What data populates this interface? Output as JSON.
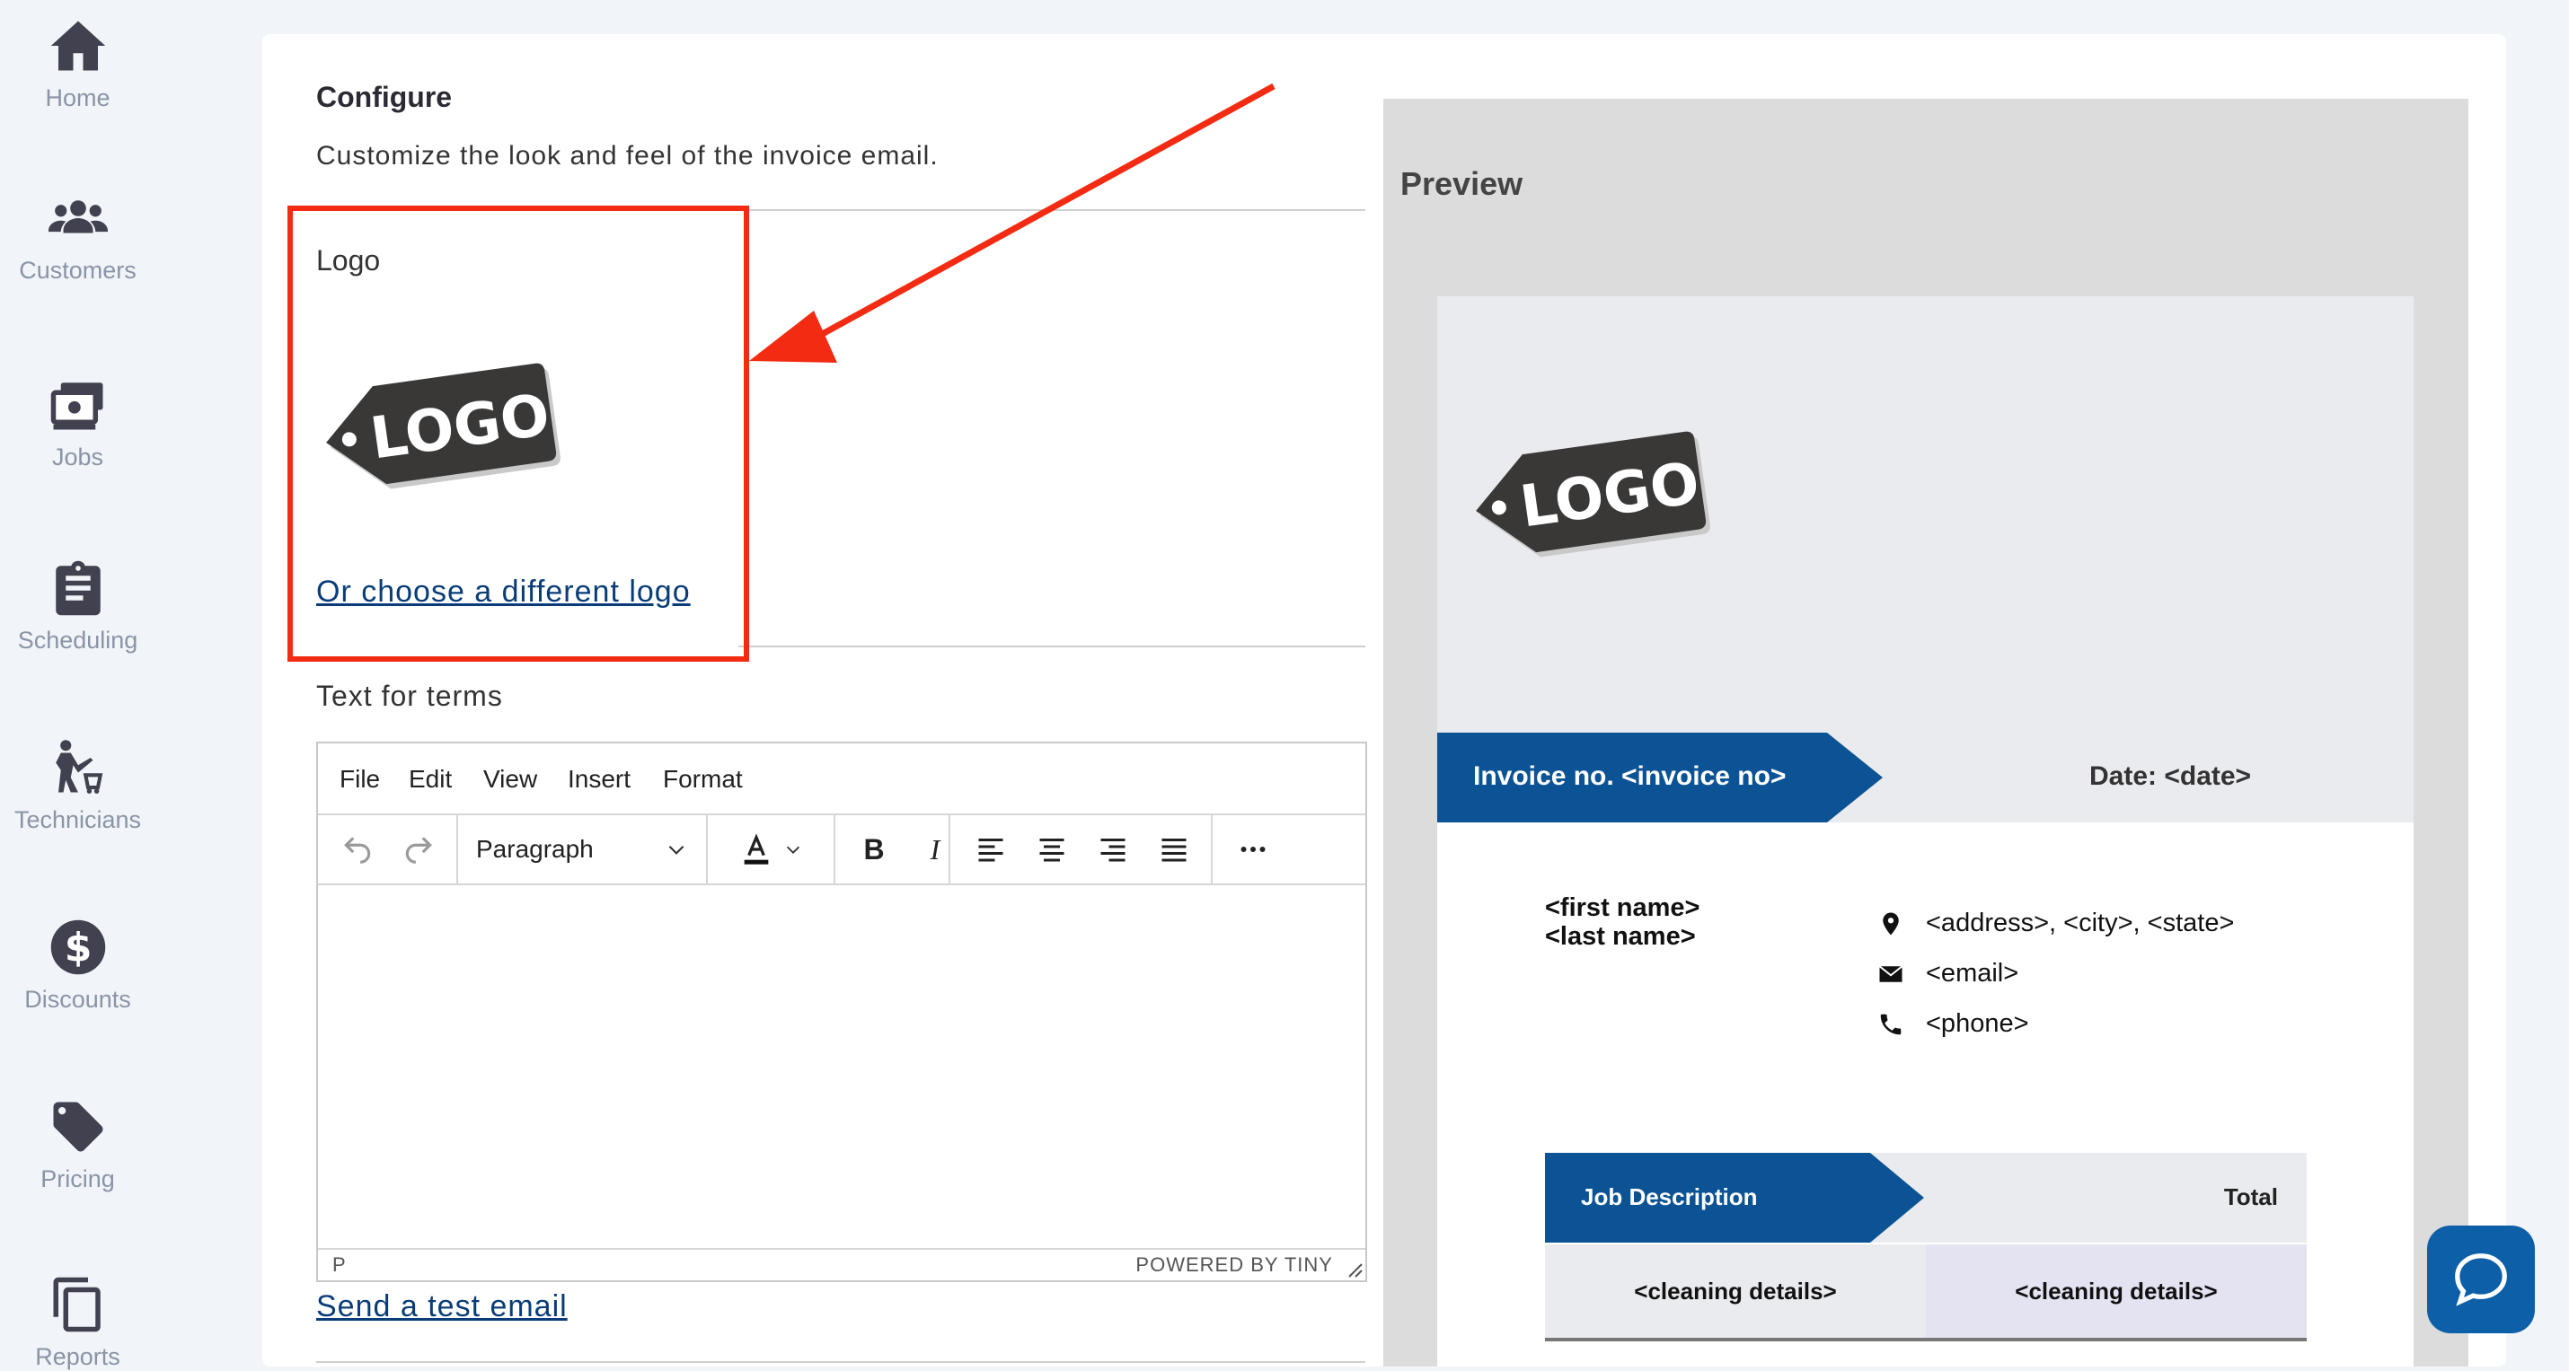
{
  "sidebar": {
    "items": [
      {
        "label": "Home",
        "icon": "home-icon"
      },
      {
        "label": "Customers",
        "icon": "customers-icon"
      },
      {
        "label": "Jobs",
        "icon": "jobs-icon"
      },
      {
        "label": "Scheduling",
        "icon": "clipboard-icon"
      },
      {
        "label": "Technicians",
        "icon": "technician-icon"
      },
      {
        "label": "Discounts",
        "icon": "dollar-icon"
      },
      {
        "label": "Pricing",
        "icon": "tag-icon"
      },
      {
        "label": "Reports",
        "icon": "copy-icon"
      }
    ]
  },
  "configure": {
    "title": "Configure",
    "subtitle": "Customize the look and feel of the invoice email.",
    "logo_label": "Logo",
    "logo_text": "LOGO",
    "change_logo_link": "Or choose a different logo",
    "terms_label": "Text for terms",
    "send_test_link": "Send a test email"
  },
  "editor": {
    "menu": [
      "File",
      "Edit",
      "View",
      "Insert",
      "Format"
    ],
    "block_format": "Paragraph",
    "status_path": "P",
    "branding": "POWERED BY TINY"
  },
  "preview": {
    "title": "Preview",
    "logo_text": "LOGO",
    "invoice_no": "Invoice no. <invoice no>",
    "date": "Date: <date>",
    "first_name": "<first name>",
    "last_name": "<last name>",
    "address": "<address>, <city>, <state>",
    "email": "<email>",
    "phone": "<phone>",
    "job_description": "Job Description",
    "total": "Total",
    "cell_left": "<cleaning details>",
    "cell_right": "<cleaning details>"
  },
  "colors": {
    "accent_blue": "#0b5394",
    "annotation_red": "#f22b12",
    "link_blue": "#0a3d78",
    "chat_blue": "#0d5fa8"
  }
}
